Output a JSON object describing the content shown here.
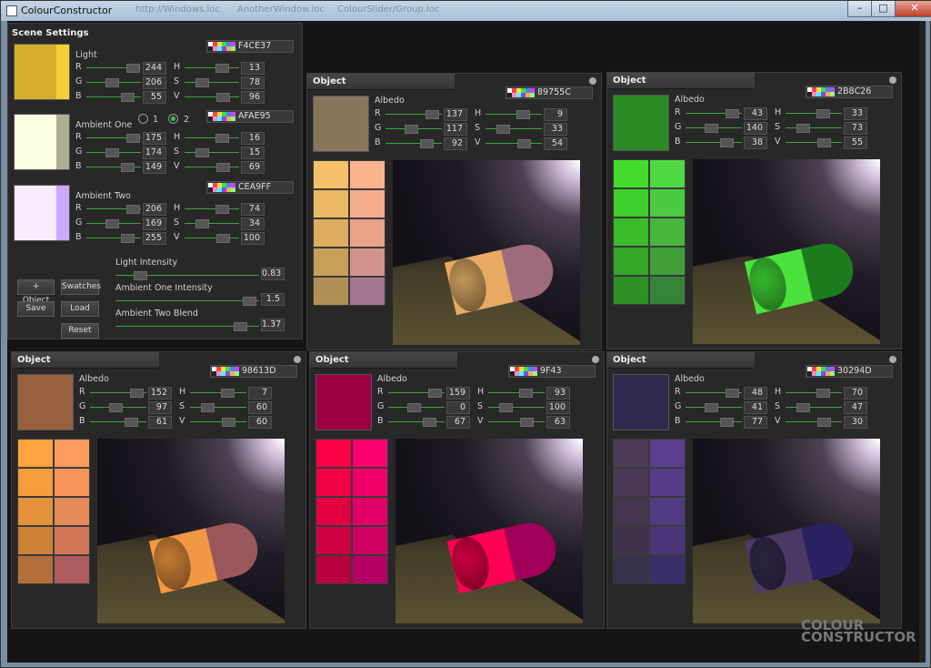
{
  "window": {
    "title": "ColourConstructor",
    "minimize": "–",
    "maximize": "□",
    "close": "✕",
    "ghost_tabs": [
      "http://Windows.loc",
      "AnotherWindow.loc",
      "ColourSlider/Group.loc"
    ]
  },
  "scene": {
    "title": "Scene Settings",
    "light": {
      "label": "Light",
      "hex": "F4CE37",
      "swatch": "#d4ad2d",
      "swatch2": "#f6ce36",
      "r": "244",
      "g": "206",
      "b": "55",
      "h": "13",
      "s": "78",
      "v": "96"
    },
    "ambient_one": {
      "label": "Ambient One",
      "hex": "AFAE95",
      "swatch": "#fbfde1",
      "swatch2": "#aeae95",
      "r": "175",
      "g": "174",
      "b": "149",
      "h": "16",
      "s": "15",
      "v": "69",
      "radio1": "1",
      "radio2": "2"
    },
    "ambient_two": {
      "label": "Ambient Two",
      "hex": "CEA9FF",
      "swatch": "#f8ebff",
      "swatch2": "#cda9fe",
      "r": "206",
      "g": "169",
      "b": "255",
      "h": "74",
      "s": "34",
      "v": "100"
    },
    "light_intensity": {
      "label": "Light Intensity",
      "value": "0.83"
    },
    "ambient_one_intensity": {
      "label": "Ambient One Intensity",
      "value": "1.5"
    },
    "ambient_two_blend": {
      "label": "Ambient Two Blend",
      "value": "1.37"
    },
    "buttons": {
      "add_object": "+ Object",
      "swatches": "Swatches",
      "save": "Save",
      "load": "Load",
      "reset": "Reset"
    }
  },
  "labels": {
    "r": "R",
    "g": "G",
    "b": "B",
    "h": "H",
    "s": "S",
    "v": "V",
    "object": "Object",
    "albedo": "Albedo"
  },
  "objects": [
    {
      "hex": "89755C",
      "color": "#89755c",
      "r": "137",
      "g": "117",
      "b": "92",
      "h": "9",
      "s": "33",
      "v": "54",
      "swatches": [
        "#f4c16a",
        "#fbb38f",
        "#ebb866",
        "#f6ad8e",
        "#dcad5f",
        "#e9a388",
        "#c89f58",
        "#d3938b",
        "#b38f58",
        "#a57690"
      ],
      "cyl_a": "#c0975a",
      "cyl_b": "#e8aa62",
      "cyl_c": "#9e6b7c"
    },
    {
      "hex": "2B8C26",
      "color": "#2b8c26",
      "r": "43",
      "g": "140",
      "b": "38",
      "h": "33",
      "s": "73",
      "v": "55",
      "swatches": [
        "#44dd2e",
        "#4fd842",
        "#3fcf2c",
        "#4bcb40",
        "#3abb2a",
        "#46b63d",
        "#34a628",
        "#419f39",
        "#2d8f25",
        "#36833a"
      ],
      "cyl_a": "#34b82c",
      "cyl_b": "#4be23d",
      "cyl_c": "#1c7b1c"
    },
    {
      "hex": "98613D",
      "color": "#98613d",
      "r": "152",
      "g": "97",
      "b": "61",
      "h": "7",
      "s": "60",
      "v": "60",
      "swatches": [
        "#fda33f",
        "#fd9c5c",
        "#f59c3d",
        "#f6925b",
        "#e4933a",
        "#e78a59",
        "#cd8038",
        "#d0775a",
        "#b26f3b",
        "#ad5b5c"
      ],
      "cyl_a": "#c47a32",
      "cyl_b": "#f19845",
      "cyl_c": "#9a575c"
    },
    {
      "hex": "9F43",
      "color": "#9f0043",
      "r": "159",
      "g": "0",
      "b": "67",
      "h": "93",
      "s": "100",
      "v": "63",
      "swatches": [
        "#fd0046",
        "#fb0071",
        "#f20044",
        "#f1006c",
        "#e20043",
        "#e00067",
        "#cd0040",
        "#ce0064",
        "#b8003d",
        "#b40065"
      ],
      "cyl_a": "#c8003e",
      "cyl_b": "#ff0055",
      "cyl_c": "#a1005a"
    },
    {
      "hex": "30294D",
      "color": "#30294d",
      "r": "48",
      "g": "41",
      "b": "77",
      "h": "70",
      "s": "47",
      "v": "30",
      "swatches": [
        "#4e3b59",
        "#5b3e8e",
        "#4a3854",
        "#563b88",
        "#45354f",
        "#503a81",
        "#3f324a",
        "#4a3679",
        "#363048",
        "#3a2f6a"
      ],
      "cyl_a": "#2a2442",
      "cyl_b": "#4b3a66",
      "cyl_c": "#2a2160"
    }
  ],
  "logo": {
    "line1": "COLOUR",
    "line2": "CONSTRUCTOR"
  }
}
